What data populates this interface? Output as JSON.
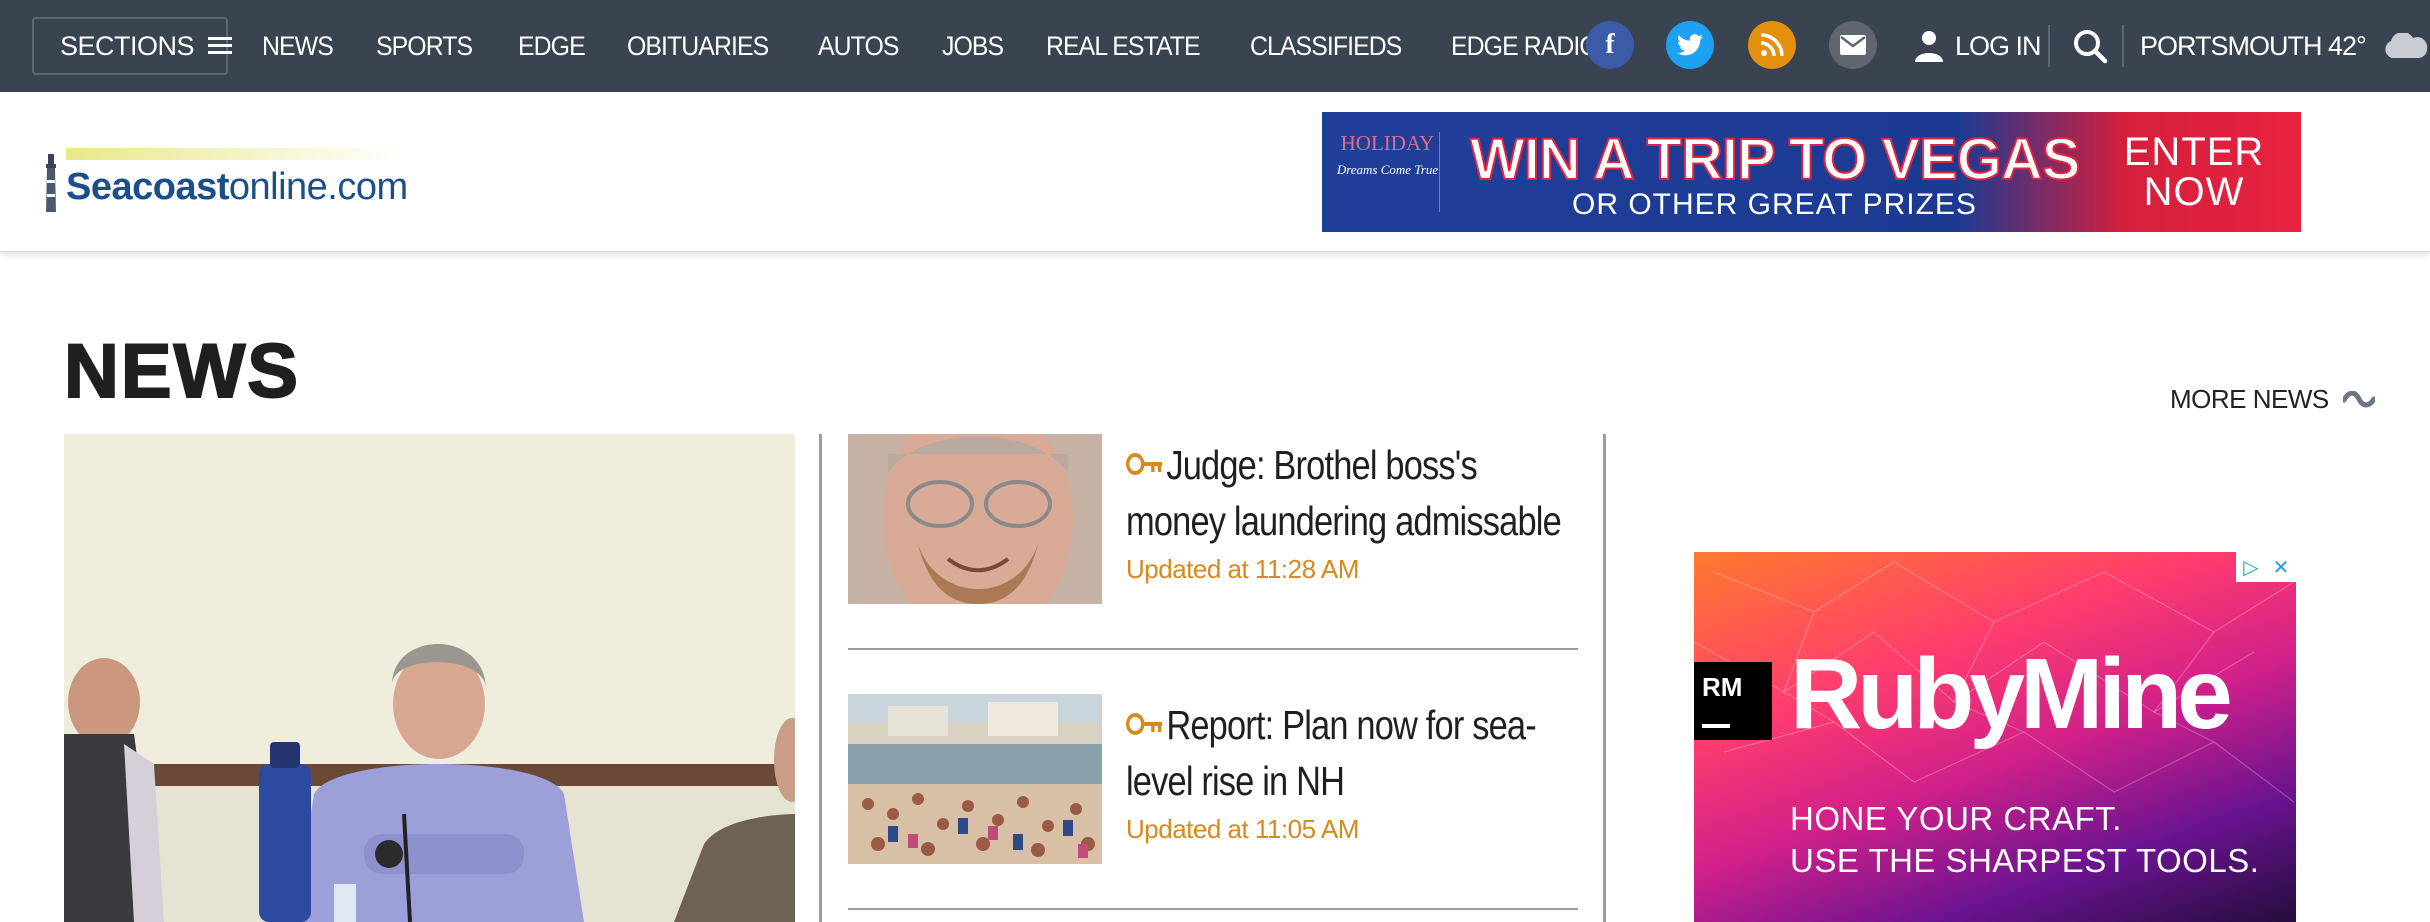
{
  "nav": {
    "sections_label": "SECTIONS",
    "links": [
      "NEWS",
      "SPORTS",
      "EDGE",
      "OBITUARIES",
      "AUTOS",
      "JOBS",
      "REAL ESTATE",
      "CLASSIFIEDS",
      "EDGE RADIO"
    ],
    "social": [
      {
        "name": "facebook-icon",
        "glyph": "f",
        "color": "#3b5ba8"
      },
      {
        "name": "twitter-icon",
        "color": "#1da1f2"
      },
      {
        "name": "rss-icon",
        "color": "#e2900e"
      },
      {
        "name": "email-icon",
        "color": "#5f6670"
      }
    ],
    "login_label": "LOG IN",
    "weather": "PORTSMOUTH 42°",
    "background": "#3a4350"
  },
  "header": {
    "logo_bold": "Seacoast",
    "logo_light": "online.com",
    "ad": {
      "badge_line1": "HOLIDAY",
      "badge_line2": "Dreams Come True",
      "headline": "WIN A TRIP TO VEGAS",
      "subline": "OR OTHER GREAT PRIZES",
      "cta_line1": "ENTER",
      "cta_line2": "NOW"
    }
  },
  "section": {
    "title": "NEWS",
    "more_label": "MORE NEWS"
  },
  "stories": [
    {
      "title": "Judge: Brothel boss's money laundering admissable",
      "updated": "Updated at 11:28 AM",
      "premium": true
    },
    {
      "title": "Report: Plan now for sea-level rise in NH",
      "updated": "Updated at 11:05 AM",
      "premium": true
    }
  ],
  "side_ad": {
    "badge": "RM",
    "brand": "RubyMine",
    "tagline1": "HONE YOUR CRAFT.",
    "tagline2": "USE THE SHARPEST TOOLS."
  },
  "colors": {
    "accent_orange": "#d58a1b",
    "logo_blue": "#1a4f8a"
  }
}
